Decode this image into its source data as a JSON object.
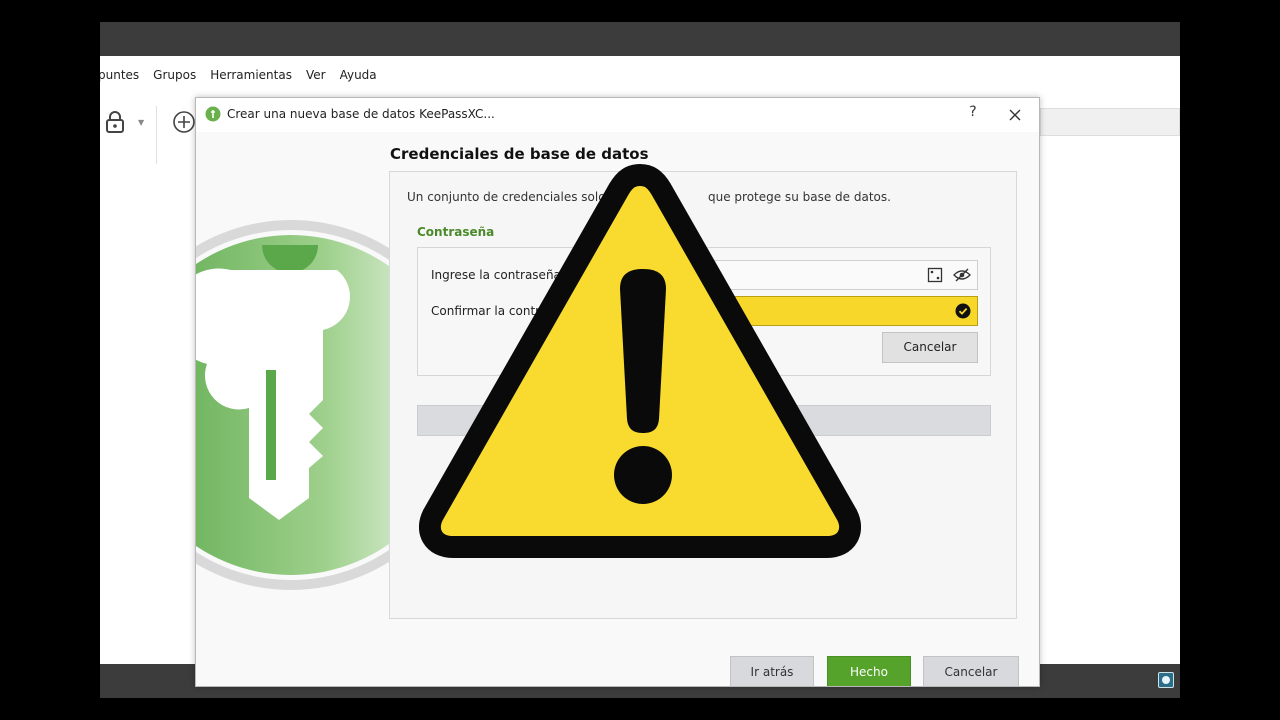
{
  "app": {
    "menu": [
      "puntes",
      "Grupos",
      "Herramientas",
      "Ver",
      "Ayuda"
    ]
  },
  "dialog": {
    "title": "Crear una nueva base de datos KeePassXC...",
    "help": "?",
    "heading": "Credenciales de base de datos",
    "intro": "Un conjunto de credenciales solo c",
    "intro_tail": "que protege su base de datos.",
    "password_section": "Contraseña",
    "enter_label": "Ingrese la contraseña",
    "confirm_label": "Confirmar la contra",
    "inline_cancel": "Cancelar",
    "buttons": {
      "back": "Ir atrás",
      "done": "Hecho",
      "cancel": "Cancelar"
    }
  },
  "colors": {
    "accent_green": "#55a32a",
    "confirm_field": "#f7d82a",
    "warning_yellow": "#f8db2e"
  },
  "icons": [
    "lock-icon",
    "add-icon",
    "keepassxc-logo-icon",
    "close-icon",
    "password-generator-icon",
    "eye-slash-icon",
    "check-circle-icon",
    "warning-icon"
  ]
}
